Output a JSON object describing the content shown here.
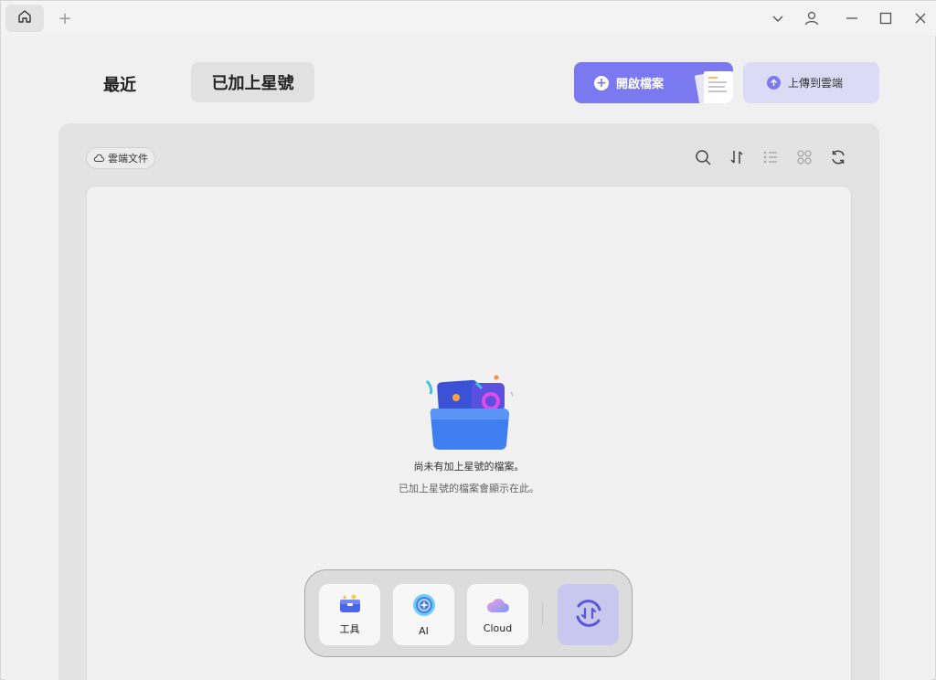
{
  "titlebar": {
    "home_icon": "home-icon",
    "add_tab_label": "+",
    "controls": [
      "chevron-down-icon",
      "user-icon",
      "minimize-icon",
      "maximize-icon",
      "close-icon"
    ]
  },
  "tabs": {
    "recent": "最近",
    "starred": "已加上星號"
  },
  "actions": {
    "open_label": "開啟檔案",
    "upload_label": "上傳到雲端"
  },
  "cloud_chip": {
    "label": "雲端文件",
    "icon": "cloud-icon"
  },
  "toolbar": [
    "search-icon",
    "sort-icon",
    "list-view-icon",
    "grid-view-icon",
    "refresh-icon"
  ],
  "empty_state": {
    "title": "尚未有加上星號的檔案。",
    "subtitle": "已加上星號的檔案會顯示在此。",
    "icon": "folder-illustration-icon"
  },
  "dock": {
    "items": [
      {
        "label": "工具",
        "icon": "toolbox-icon"
      },
      {
        "label": "AI",
        "icon": "ai-orb-icon"
      },
      {
        "label": "Cloud",
        "icon": "cloud-icon"
      }
    ],
    "sync_icon": "sync-icon"
  },
  "colors": {
    "accent": "#7b79f0",
    "accent_light": "#dcdbf6",
    "panel": "#e3e3e3"
  }
}
